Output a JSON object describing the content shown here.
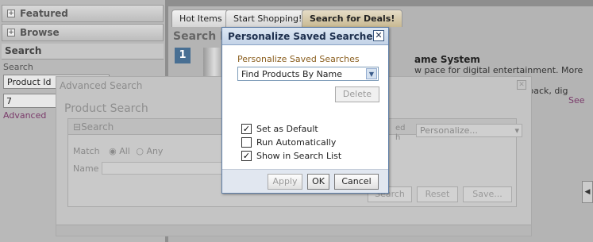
{
  "left": {
    "featured": "Featured",
    "browse": "Browse",
    "search_header": "Search",
    "search_label": "Search",
    "product_select": "Product Id",
    "field_value": "7",
    "advanced_link": "Advanced"
  },
  "tabs": [
    {
      "label": "Hot Items"
    },
    {
      "label": "Start Shopping!"
    },
    {
      "label": "Search for Deals!"
    }
  ],
  "main": {
    "results_title": "Search R",
    "result_number": "1",
    "product_title": "ame System",
    "desc_line1": "w pace for digital entertainment. More than just a",
    "desc_line2": "playback, dig",
    "see_link": "See"
  },
  "advanced": {
    "title": "Advanced Search",
    "product_search": "Product Search",
    "section": "Search",
    "match_label": "Match",
    "all_label": "All",
    "any_label": "Any",
    "name_label": "Name",
    "saved_search_label_1": "ed",
    "saved_search_label_2": "h",
    "personalize_select": "Personalize...",
    "search_btn": "Search",
    "reset_btn": "Reset",
    "save_btn": "Save..."
  },
  "dialog": {
    "title": "Personalize Saved Searches",
    "section_label": "Personalize Saved Searches",
    "selected_search": "Find Products By Name",
    "delete": "Delete",
    "options": [
      {
        "label": "Set as Default",
        "checked": true
      },
      {
        "label": "Run Automatically",
        "checked": false
      },
      {
        "label": "Show in Search List",
        "checked": true
      }
    ],
    "apply": "Apply",
    "ok": "OK",
    "cancel": "Cancel"
  },
  "colors": {
    "accent": "#486f93",
    "dialog_border": "#5f7fa8",
    "label_brown": "#8a5e1e"
  }
}
